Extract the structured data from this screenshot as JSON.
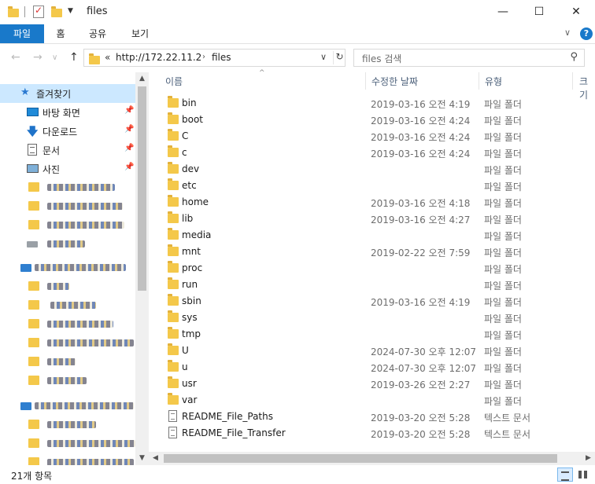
{
  "window": {
    "title": "files",
    "minimize_glyph": "—",
    "maximize_glyph": "☐",
    "close_glyph": "✕"
  },
  "ribbon": {
    "tabs": [
      "파일",
      "홈",
      "공유",
      "보기"
    ],
    "collapse_glyph": "∨",
    "help_glyph": "?"
  },
  "navigation": {
    "back_glyph": "←",
    "forward_glyph": "→",
    "recent_glyph": "∨",
    "up_glyph": "↑",
    "address": {
      "overflow": "«",
      "segments": [
        "http://172.22.11.2",
        "files"
      ],
      "separator": "›",
      "dropdown_glyph": "∨",
      "refresh_glyph": "↻"
    },
    "search": {
      "placeholder": "files 검색",
      "icon": "search-icon"
    }
  },
  "nav_pane": {
    "quick_access": "즐겨찾기",
    "pinned": [
      {
        "label": "바탕 화면",
        "icon": "desktop-icon"
      },
      {
        "label": "다운로드",
        "icon": "download-icon"
      },
      {
        "label": "문서",
        "icon": "documents-icon"
      },
      {
        "label": "사진",
        "icon": "pictures-icon"
      }
    ],
    "pin_glyph": "📌",
    "scroll_up_glyph": "▲",
    "scroll_down_glyph": "▼"
  },
  "columns": {
    "name": "이름",
    "date": "수정한 날짜",
    "type": "유형",
    "size": "크기",
    "sort_glyph": "^"
  },
  "files": [
    {
      "name": "bin",
      "date": "2019-03-16 오전 4:19",
      "type": "파일 폴더",
      "kind": "folder"
    },
    {
      "name": "boot",
      "date": "2019-03-16 오전 4:24",
      "type": "파일 폴더",
      "kind": "folder"
    },
    {
      "name": "C",
      "date": "2019-03-16 오전 4:24",
      "type": "파일 폴더",
      "kind": "folder"
    },
    {
      "name": "c",
      "date": "2019-03-16 오전 4:24",
      "type": "파일 폴더",
      "kind": "folder"
    },
    {
      "name": "dev",
      "date": "",
      "type": "파일 폴더",
      "kind": "folder"
    },
    {
      "name": "etc",
      "date": "",
      "type": "파일 폴더",
      "kind": "folder"
    },
    {
      "name": "home",
      "date": "2019-03-16 오전 4:18",
      "type": "파일 폴더",
      "kind": "folder"
    },
    {
      "name": "lib",
      "date": "2019-03-16 오전 4:27",
      "type": "파일 폴더",
      "kind": "folder"
    },
    {
      "name": "media",
      "date": "",
      "type": "파일 폴더",
      "kind": "folder"
    },
    {
      "name": "mnt",
      "date": "2019-02-22 오전 7:59",
      "type": "파일 폴더",
      "kind": "folder"
    },
    {
      "name": "proc",
      "date": "",
      "type": "파일 폴더",
      "kind": "folder"
    },
    {
      "name": "run",
      "date": "",
      "type": "파일 폴더",
      "kind": "folder"
    },
    {
      "name": "sbin",
      "date": "2019-03-16 오전 4:19",
      "type": "파일 폴더",
      "kind": "folder"
    },
    {
      "name": "sys",
      "date": "",
      "type": "파일 폴더",
      "kind": "folder"
    },
    {
      "name": "tmp",
      "date": "",
      "type": "파일 폴더",
      "kind": "folder"
    },
    {
      "name": "U",
      "date": "2024-07-30 오후 12:07",
      "type": "파일 폴더",
      "kind": "folder"
    },
    {
      "name": "u",
      "date": "2024-07-30 오후 12:07",
      "type": "파일 폴더",
      "kind": "folder"
    },
    {
      "name": "usr",
      "date": "2019-03-26 오전 2:27",
      "type": "파일 폴더",
      "kind": "folder"
    },
    {
      "name": "var",
      "date": "",
      "type": "파일 폴더",
      "kind": "folder"
    },
    {
      "name": "README_File_Paths",
      "date": "2019-03-20 오전 5:28",
      "type": "텍스트 문서",
      "kind": "text"
    },
    {
      "name": "README_File_Transfer",
      "date": "2019-03-20 오전 5:28",
      "type": "텍스트 문서",
      "kind": "text"
    }
  ],
  "hscroll": {
    "left_glyph": "◀",
    "right_glyph": "▶"
  },
  "status": {
    "item_count": "21개 항목"
  }
}
